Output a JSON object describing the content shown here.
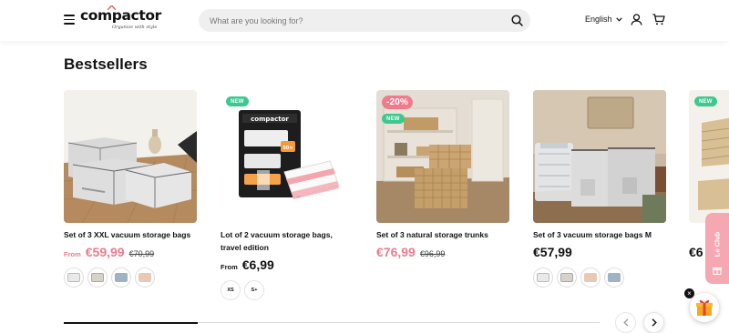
{
  "header": {
    "logo": "compactor",
    "tagline": "Organize with style",
    "search_placeholder": "What are you looking for?",
    "language": "English"
  },
  "section": {
    "title": "Bestsellers"
  },
  "products": [
    {
      "name": "Set of 3 XXL vacuum storage bags",
      "from": "From",
      "price": "€59,99",
      "old_price": "€70,99",
      "sale": true,
      "swatch_colors": [
        "#e9e9e9",
        "#d6d3c6",
        "#9fb3c4",
        "#e9c8b6"
      ]
    },
    {
      "name": "Lot of 2 vacuum storage bags, travel edition",
      "badge": "NEW",
      "from": "From",
      "price": "€6,99",
      "sizes": [
        "XS",
        "S+"
      ]
    },
    {
      "name": "Set of 3 natural storage trunks",
      "discount": "-20%",
      "badge": "NEW",
      "price": "€76,99",
      "old_price": "€96,99",
      "sale": true
    },
    {
      "name": "Set of 3 vacuum storage bags M",
      "price": "€57,99",
      "swatch_colors": [
        "#e9e9e9",
        "#d8d2c8",
        "#e9c8b6",
        "#9fb3c4"
      ]
    },
    {
      "name": "",
      "badge": "NEW",
      "price": "€6"
    }
  ],
  "club": {
    "label": "Le Club"
  },
  "colors": {
    "accent_pink": "#f07b8b",
    "new_green": "#3cc88f",
    "club_pink": "#f5a8b2"
  },
  "icons": [
    "menu-icon",
    "search-icon",
    "user-icon",
    "cart-icon",
    "chevron-down-icon",
    "chevron-left-icon",
    "chevron-right-icon",
    "gift-icon",
    "close-icon"
  ],
  "carousel": {
    "progress": 0.25
  }
}
